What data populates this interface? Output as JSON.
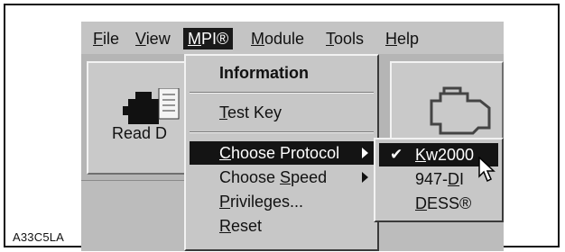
{
  "caption": "A33C5LA",
  "menubar": {
    "items": [
      {
        "label": "File",
        "ul": "F",
        "rest": "ile"
      },
      {
        "label": "View",
        "ul": "V",
        "rest": "iew"
      },
      {
        "label": "MPI®",
        "ul": "M",
        "rest": "PI®"
      },
      {
        "label": "Module",
        "ul": "M",
        "rest": "odule"
      },
      {
        "label": "Tools",
        "ul": "T",
        "rest": "ools"
      },
      {
        "label": "Help",
        "ul": "H",
        "rest": "elp"
      }
    ]
  },
  "toolbar": {
    "read_label": "Read D"
  },
  "mpi_menu": {
    "information": "Information",
    "test_key": {
      "ul": "T",
      "rest": "est Key"
    },
    "choose_protocol": {
      "ul": "C",
      "rest": "hoose Protocol"
    },
    "choose_speed": {
      "pre": "Choose ",
      "ul": "S",
      "rest": "peed"
    },
    "privileges": {
      "ul": "P",
      "rest": "rivileges..."
    },
    "reset": {
      "ul": "R",
      "rest": "eset"
    }
  },
  "protocol_menu": {
    "kw2000": {
      "ul": "K",
      "rest": "w2000"
    },
    "di947": {
      "pre": "947-",
      "ul": "D",
      "rest": "I"
    },
    "dess": {
      "ul": "D",
      "rest": "ESS®"
    },
    "checked_mark": "✔"
  }
}
